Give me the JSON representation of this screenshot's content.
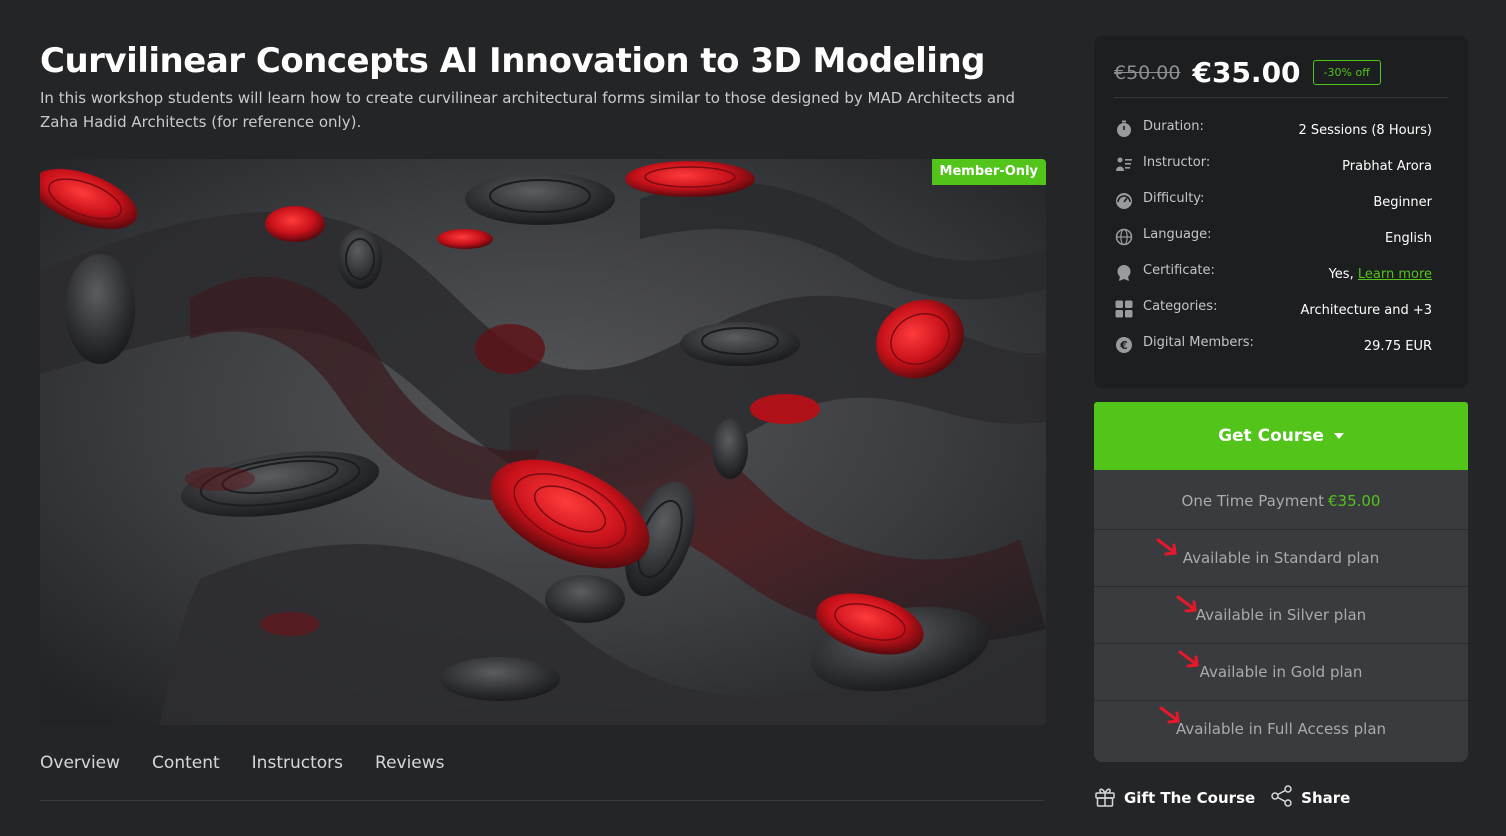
{
  "course": {
    "title": "Curvilinear Concepts AI Innovation to 3D Modeling",
    "description": "In this workshop students will learn how to create curvilinear architectural forms similar to those designed by MAD Architects and Zaha Hadid Architects (for reference only).",
    "badge": "Member-Only"
  },
  "tabs": [
    "Overview",
    "Content",
    "Instructors",
    "Reviews"
  ],
  "pricing": {
    "old_price": "€50.00",
    "new_price": "€35.00",
    "discount": "-30% off"
  },
  "info": {
    "duration": {
      "label": "Duration:",
      "value": "2 Sessions (8 Hours)",
      "icon": "stopwatch-icon"
    },
    "instructor": {
      "label": "Instructor:",
      "value": "Prabhat Arora",
      "icon": "instructor-icon"
    },
    "difficulty": {
      "label": "Difficulty:",
      "value": "Beginner",
      "icon": "difficulty-icon"
    },
    "language": {
      "label": "Language:",
      "value": "English",
      "icon": "globe-icon"
    },
    "certificate": {
      "label": "Certificate:",
      "value": "Yes,",
      "link": "Learn more",
      "icon": "certificate-icon"
    },
    "categories": {
      "label": "Categories:",
      "value": "Architecture and +3",
      "icon": "grid-icon"
    },
    "members": {
      "label": "Digital Members:",
      "value": "29.75 EUR",
      "icon": "euro-coin-icon"
    }
  },
  "cta": {
    "get_course": "Get Course",
    "one_time_label": "One Time Payment",
    "one_time_price": "€35.00",
    "plans": [
      "Available in Standard plan",
      "Available in Silver plan",
      "Available in Gold plan",
      "Available in Full Access plan"
    ]
  },
  "actions": {
    "gift": "Gift The Course",
    "share": "Share"
  },
  "colors": {
    "accent": "#52c41a",
    "background": "#242527",
    "card": "#1d1e20",
    "plan_bg": "#3a3b3e",
    "arrow": "#e8182b"
  }
}
